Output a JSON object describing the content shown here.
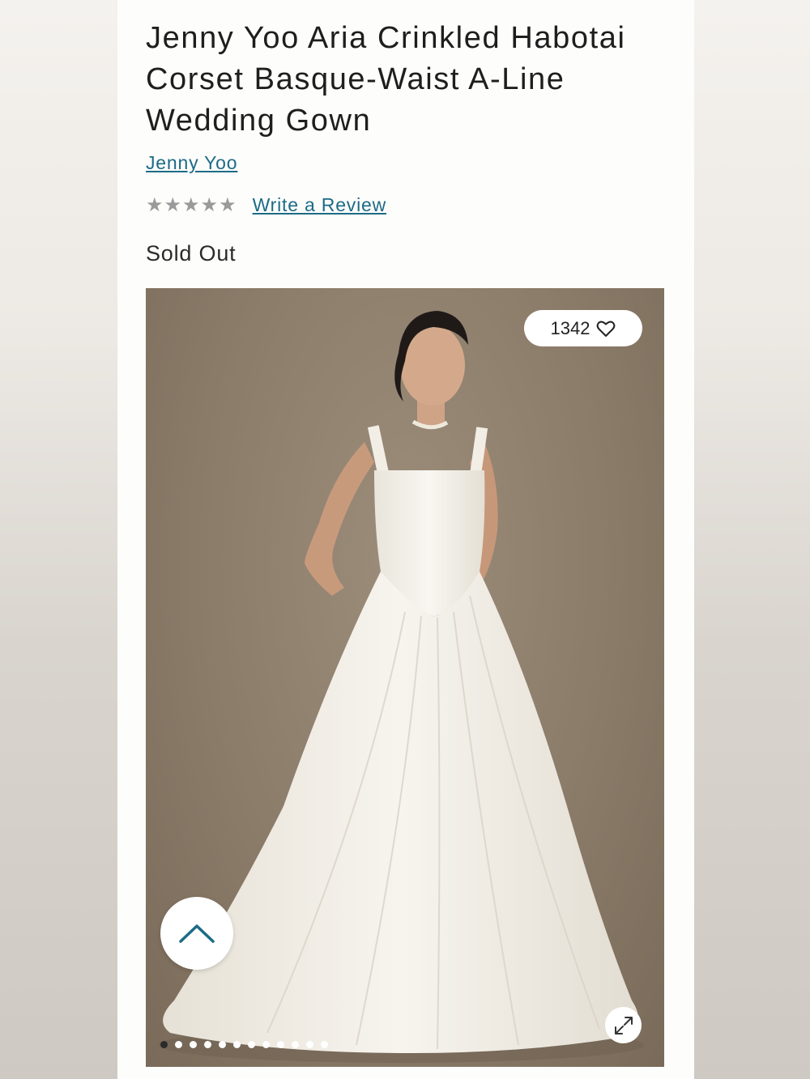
{
  "product": {
    "title": "Jenny Yoo Aria Crinkled Habotai Corset Basque-Waist A-Line Wedding Gown",
    "brand": "Jenny Yoo",
    "rating": {
      "stars": 5,
      "filled": 0,
      "review_link": "Write a Review"
    },
    "status": "Sold Out"
  },
  "gallery": {
    "likes": "1342",
    "image_count": 12,
    "active_index": 0,
    "icons": {
      "like": "heart-icon",
      "scroll": "chevron-up-icon",
      "expand": "expand-icon"
    }
  },
  "colors": {
    "link": "#1c6b87",
    "star": "#9a9a9a",
    "backdrop": "#8b7b69"
  }
}
